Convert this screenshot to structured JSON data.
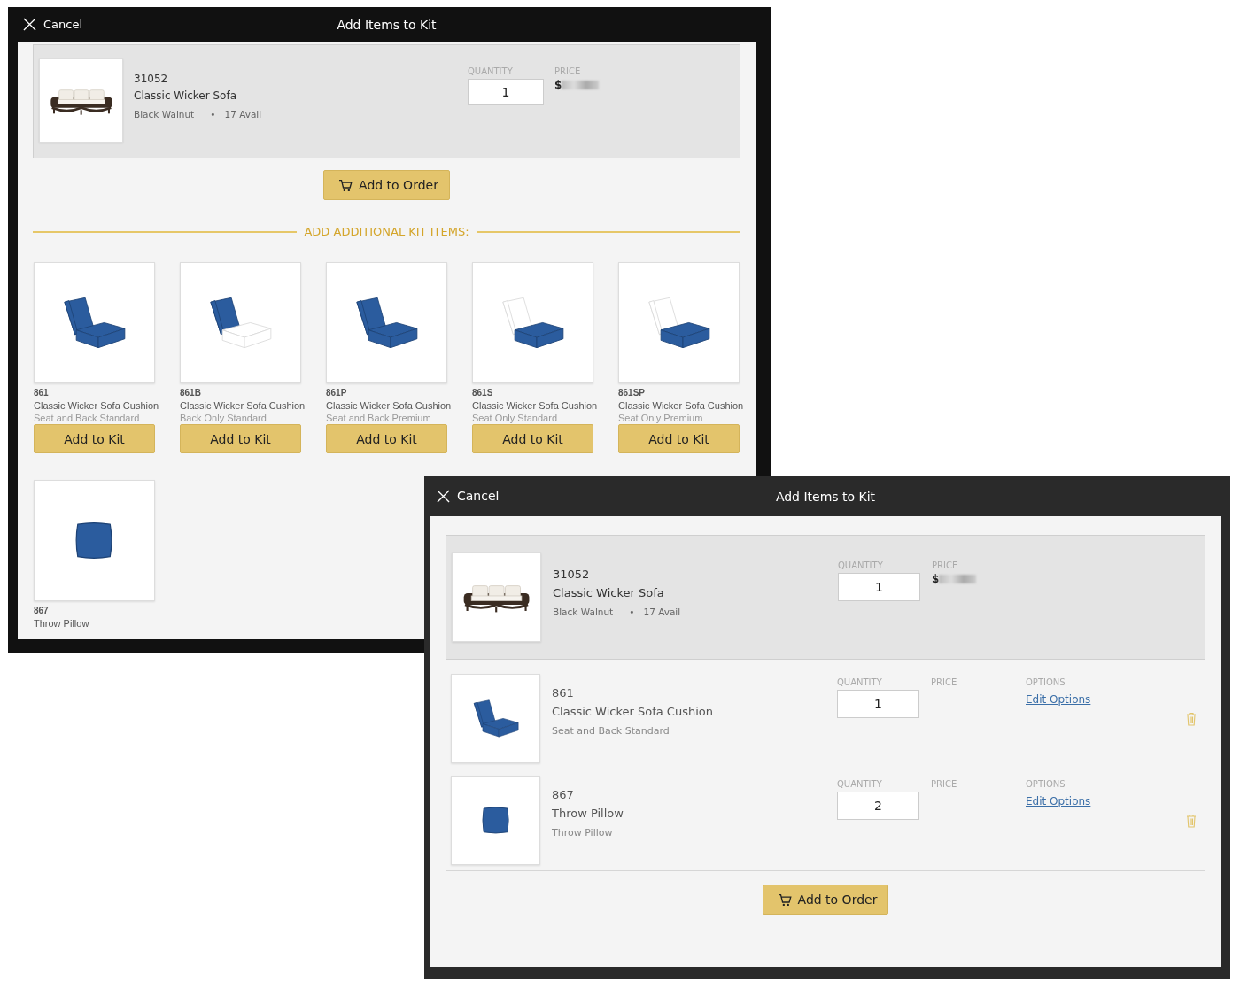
{
  "kit_builder": {
    "cancel": "Cancel",
    "title": "Add Items to Kit",
    "main_item": {
      "kind": "sofa",
      "code": "31052",
      "name": "Classic Wicker Sofa",
      "finish": "Black Walnut",
      "separator": "•",
      "availability": "17 Avail",
      "quantity_label": "QUANTITY",
      "quantity": "1",
      "price_label": "PRICE",
      "price": "$"
    },
    "order_button": "Add to Order",
    "section_heading": "ADD ADDITIONAL KIT ITEMS:",
    "kit_items": [
      {
        "kind": "seat-and-back",
        "code": "861",
        "name": "Classic Wicker Sofa Cushion",
        "variant": "Seat and Back Standard",
        "button": "Add to Kit"
      },
      {
        "kind": "back-only",
        "code": "861B",
        "name": "Classic Wicker Sofa Cushion",
        "variant": "Back Only Standard",
        "button": "Add to Kit"
      },
      {
        "kind": "seat-and-back",
        "code": "861P",
        "name": "Classic Wicker Sofa Cushion",
        "variant": "Seat and Back Premium",
        "button": "Add to Kit"
      },
      {
        "kind": "seat-only",
        "code": "861S",
        "name": "Classic Wicker Sofa Cushion",
        "variant": "Seat Only Standard",
        "button": "Add to Kit"
      },
      {
        "kind": "seat-only",
        "code": "861SP",
        "name": "Classic Wicker Sofa Cushion",
        "variant": "Seat Only Premium",
        "button": "Add to Kit"
      },
      {
        "kind": "pillow",
        "code": "867",
        "name": "Throw Pillow"
      }
    ]
  },
  "kit_summary": {
    "cancel": "Cancel",
    "title": "Add Items to Kit",
    "main_item": {
      "kind": "sofa",
      "code": "31052",
      "name": "Classic Wicker Sofa",
      "finish": "Black Walnut",
      "separator": "•",
      "availability": "17 Avail",
      "quantity_label": "QUANTITY",
      "quantity": "1",
      "price_label": "PRICE",
      "price": "$"
    },
    "kit_lines": [
      {
        "kind": "seat-and-back",
        "code": "861",
        "name": "Classic Wicker Sofa Cushion",
        "variant": "Seat and Back Standard",
        "quantity_label": "QUANTITY",
        "quantity": "1",
        "price_label": "PRICE",
        "options_label": "OPTIONS",
        "options_link": "Edit Options"
      },
      {
        "kind": "pillow",
        "code": "867",
        "name": "Throw Pillow",
        "variant": "Throw Pillow",
        "quantity_label": "QUANTITY",
        "quantity": "2",
        "price_label": "PRICE",
        "options_label": "OPTIONS",
        "options_link": "Edit Options"
      }
    ],
    "order_button": "Add to Order"
  }
}
